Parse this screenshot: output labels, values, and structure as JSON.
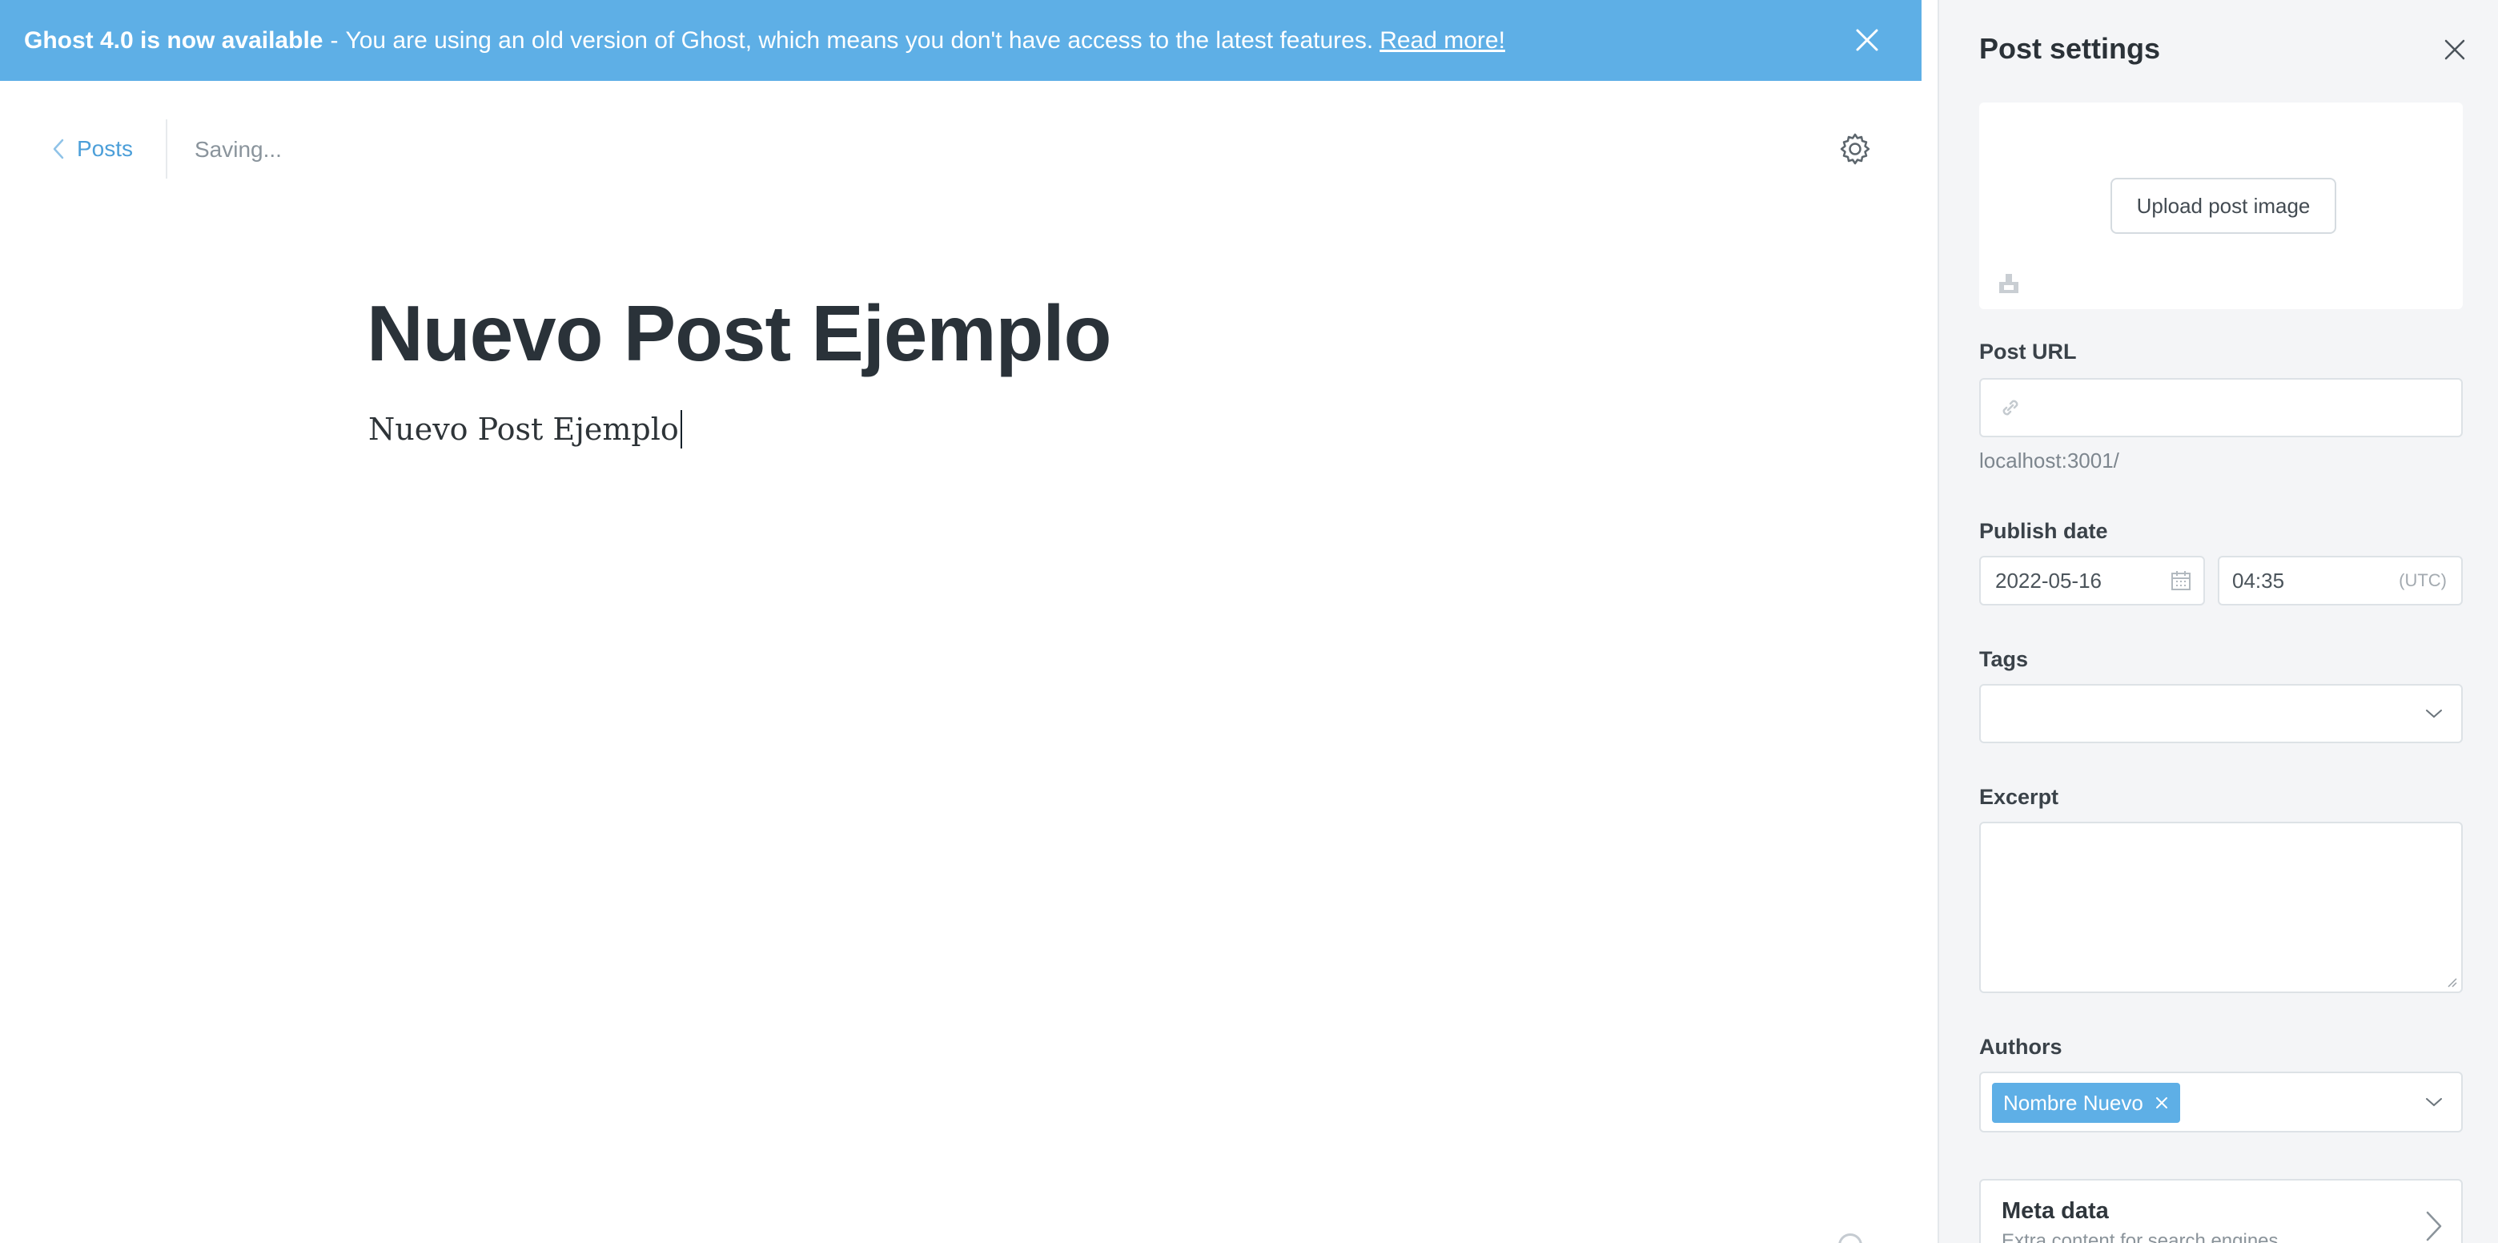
{
  "banner": {
    "headline": "Ghost 4.0 is now available",
    "separator": "-",
    "message": "You are using an old version of Ghost, which means you don't have access to the latest features.",
    "link_label": "Read more!",
    "close_icon": "close-icon"
  },
  "header": {
    "back_label": "Posts",
    "back_icon": "chevron-left-icon",
    "status": "Saving...",
    "settings_icon": "gear-icon"
  },
  "post": {
    "title": "Nuevo Post Ejemplo",
    "body": "Nuevo Post Ejemplo"
  },
  "panel": {
    "title": "Post settings",
    "close_icon": "close-icon",
    "upload_label": "Upload post image",
    "post_url": {
      "label": "Post URL",
      "value": "",
      "hint": "localhost:3001/"
    },
    "publish_date": {
      "label": "Publish date",
      "date": "2022-05-16",
      "time": "04:35",
      "timezone": "(UTC)"
    },
    "tags": {
      "label": "Tags",
      "value": ""
    },
    "excerpt": {
      "label": "Excerpt",
      "value": ""
    },
    "authors": {
      "label": "Authors",
      "selected": [
        "Nombre Nuevo"
      ]
    },
    "meta_data": {
      "title": "Meta data",
      "subtitle": "Extra content for search engines"
    }
  },
  "colors": {
    "banner_bg": "#5eafe6",
    "link_blue": "#4c9fd9",
    "panel_bg": "#f4f5f7"
  }
}
